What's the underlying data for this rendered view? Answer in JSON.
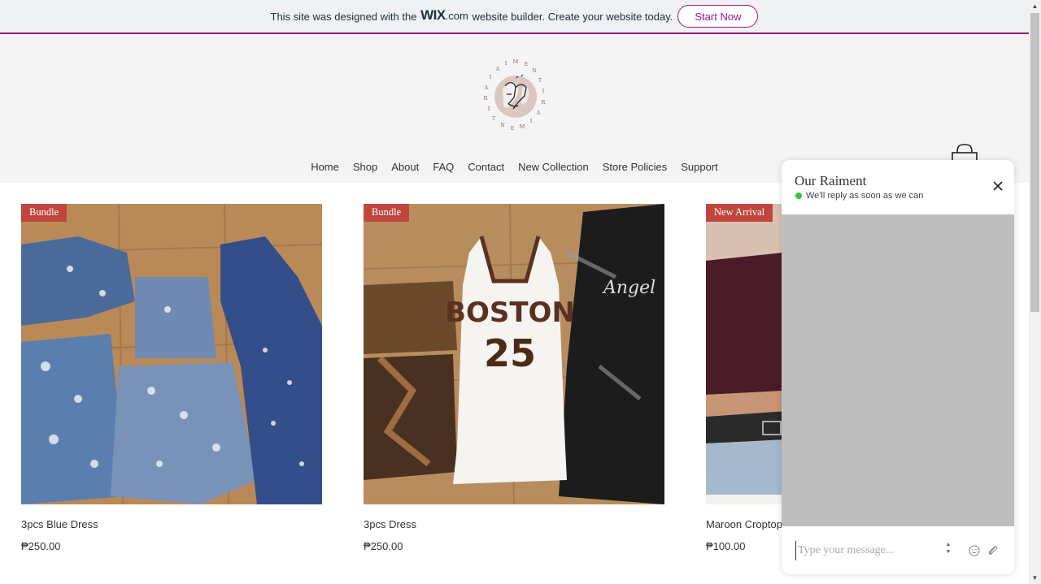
{
  "banner": {
    "text_before": "This site was designed with the",
    "wix": "WIX",
    "wix_suffix": ".com",
    "text_after": "website builder. Create your website today.",
    "button": "Start Now"
  },
  "header": {
    "logo_letters": "RAIMENT",
    "nav": [
      "Home",
      "Shop",
      "About",
      "FAQ",
      "Contact",
      "New Collection",
      "Store Policies",
      "Support"
    ]
  },
  "products": [
    {
      "badge": "Bundle",
      "name": "3pcs Blue Dress",
      "price": "₱250.00"
    },
    {
      "badge": "Bundle",
      "name": "3pcs Dress",
      "price": "₱250.00"
    },
    {
      "badge": "New Arrival",
      "name": "Maroon Croptop",
      "price": "₱100.00"
    }
  ],
  "product_images": {
    "shirt_text": "BOSTON",
    "shirt_number": "25",
    "dress_text": "Angel"
  },
  "chat": {
    "title": "Our Raiment",
    "status": "We'll reply as soon as we can",
    "placeholder": "Type your message..."
  },
  "colors": {
    "wix_accent": "#a0138e",
    "badge": "#c0463d",
    "online": "#3cbf4a"
  }
}
